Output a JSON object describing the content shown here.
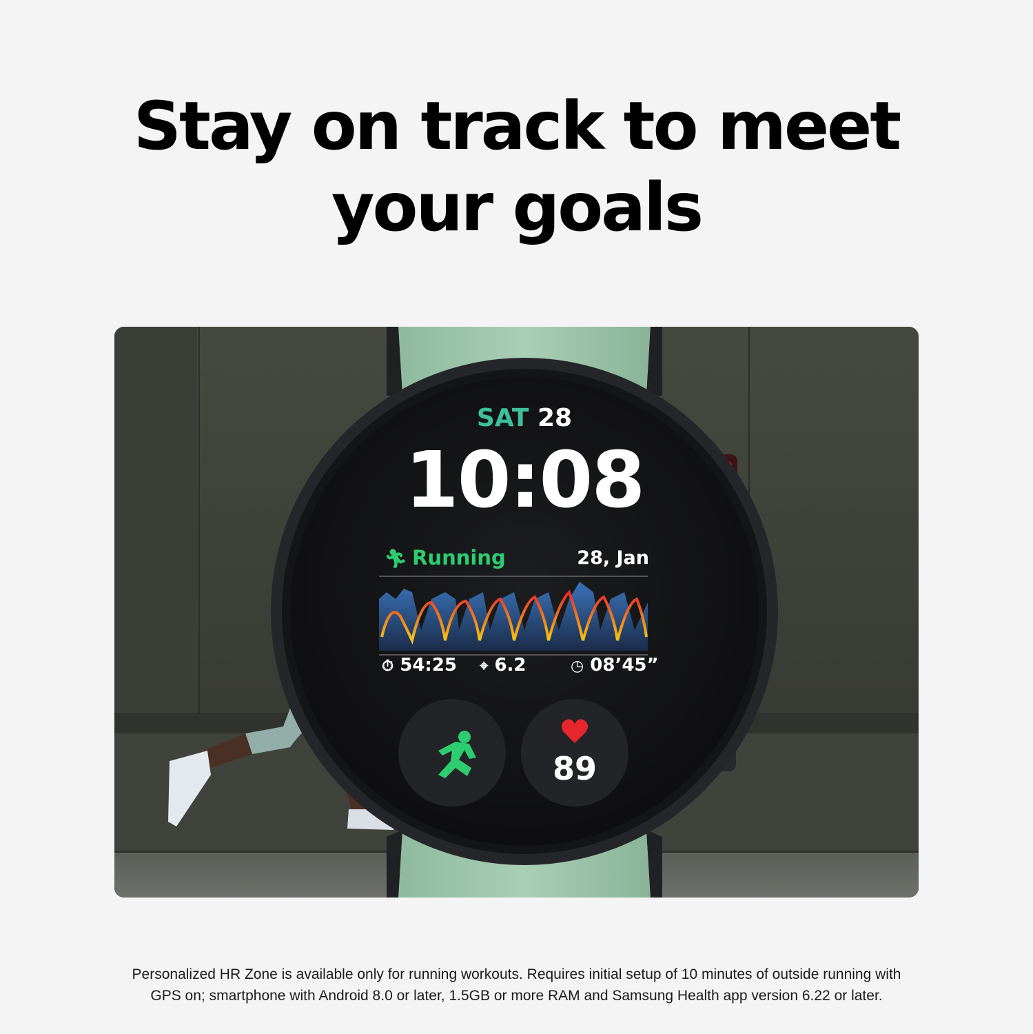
{
  "headline": {
    "line1": "Stay on track to meet",
    "line2": "your goals"
  },
  "watch_face": {
    "day": "SAT",
    "date": "28",
    "time": "10:08",
    "activity_label": "Running",
    "activity_icon": "running-icon",
    "activity_date": "28, Jan",
    "stats": {
      "duration": "54:25",
      "duration_icon": "stopwatch-icon",
      "distance": "6.2",
      "distance_icon": "location-pin-icon",
      "pace": "08’45”",
      "pace_icon": "gauge-icon"
    },
    "complications": {
      "workout_icon": "running-icon",
      "heart_icon": "heart-icon",
      "heart_rate": "89"
    }
  },
  "footnote": {
    "line1": "Personalized HR Zone is available only for running workouts. Requires initial setup of 10 minutes of outside running with",
    "line2": "GPS on; smartphone with Android 8.0 or later, 1.5GB or more RAM and Samsung Health app version 6.22 or later."
  },
  "colors": {
    "background": "#f4f4f4",
    "accent_green": "#2ecc71",
    "date_teal": "#3ec09a",
    "heart_red": "#e8262e",
    "strap_mint": "#9cc5aa",
    "case_dark": "#2a2b2f"
  }
}
